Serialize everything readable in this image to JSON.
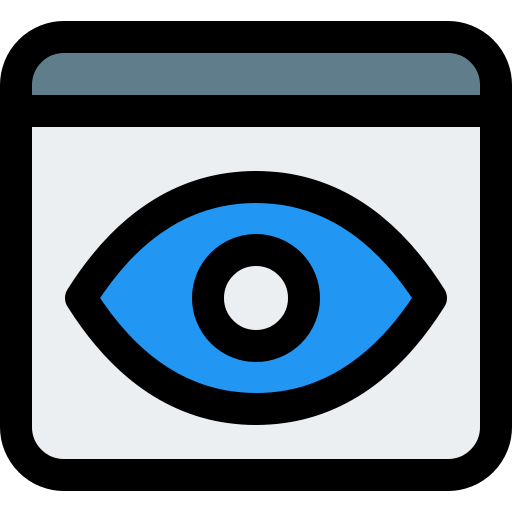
{
  "icon": {
    "name": "browser-window-eye-icon",
    "colors": {
      "outline": "#000000",
      "window_body": "#eceff1",
      "title_bar": "#607d8b",
      "iris": "#2196f3",
      "pupil": "#eceff1"
    }
  }
}
